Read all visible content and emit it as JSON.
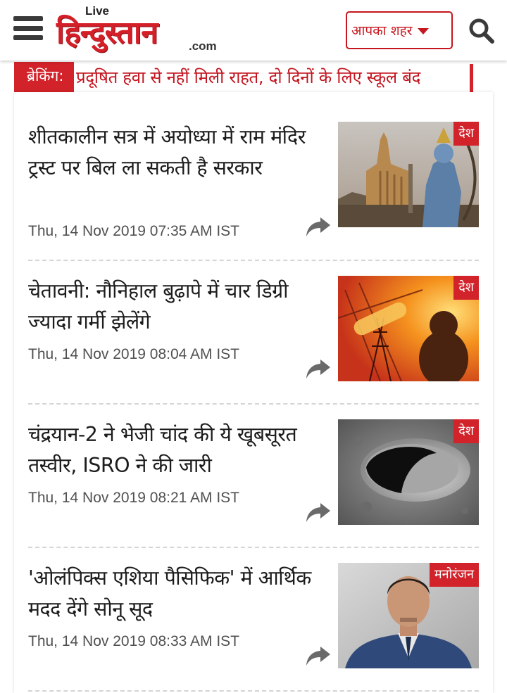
{
  "header": {
    "logo_live": "Live",
    "logo_name": "हिन्दुस्तान",
    "logo_com": ".com",
    "city_label": "आपका शहर"
  },
  "breaking": {
    "tag": "ब्रेकिंग:",
    "text": "प्रदूषित हवा से नहीं मिली राहत, दो दिनों के लिए स्कूल बंद"
  },
  "news": [
    {
      "title": "शीतकालीन सत्र में अयोध्या में राम मंदिर ट्रस्ट पर बिल ला सकती है सरकार",
      "time": "Thu, 14 Nov 2019 07:35 AM IST",
      "category": "देश",
      "image": "ayodhya-temple-ram-photo"
    },
    {
      "title": "चेतावनी: नौनिहाल बुढ़ापे में चार डिग्री ज्यादा गर्मी झेलेंगे",
      "time": "Thu, 14 Nov 2019 08:04 AM IST",
      "category": "देश",
      "image": "heatwave-thermometer-child-photo"
    },
    {
      "title": "चंद्रयान-2 ने भेजी चांद की ये खूबसूरत तस्वीर, ISRO ने की जारी",
      "time": "Thu, 14 Nov 2019 08:21 AM IST",
      "category": "देश",
      "image": "moon-crater-photo"
    },
    {
      "title": "'ओलंपिक्स एशिया पैसिफिक' में आर्थिक मदद देंगे सोनू सूद",
      "time": "Thu, 14 Nov 2019 08:33 AM IST",
      "category": "मनोरंजन",
      "image": "sonu-sood-portrait-photo"
    }
  ],
  "icons": {
    "menu": "hamburger-menu-icon",
    "search": "search-icon",
    "share": "share-arrow-icon",
    "dropdown": "caret-down-icon"
  },
  "colors": {
    "brand_red": "#d2232b",
    "text_dark": "#1c1c1c",
    "time_gray": "#505050"
  }
}
